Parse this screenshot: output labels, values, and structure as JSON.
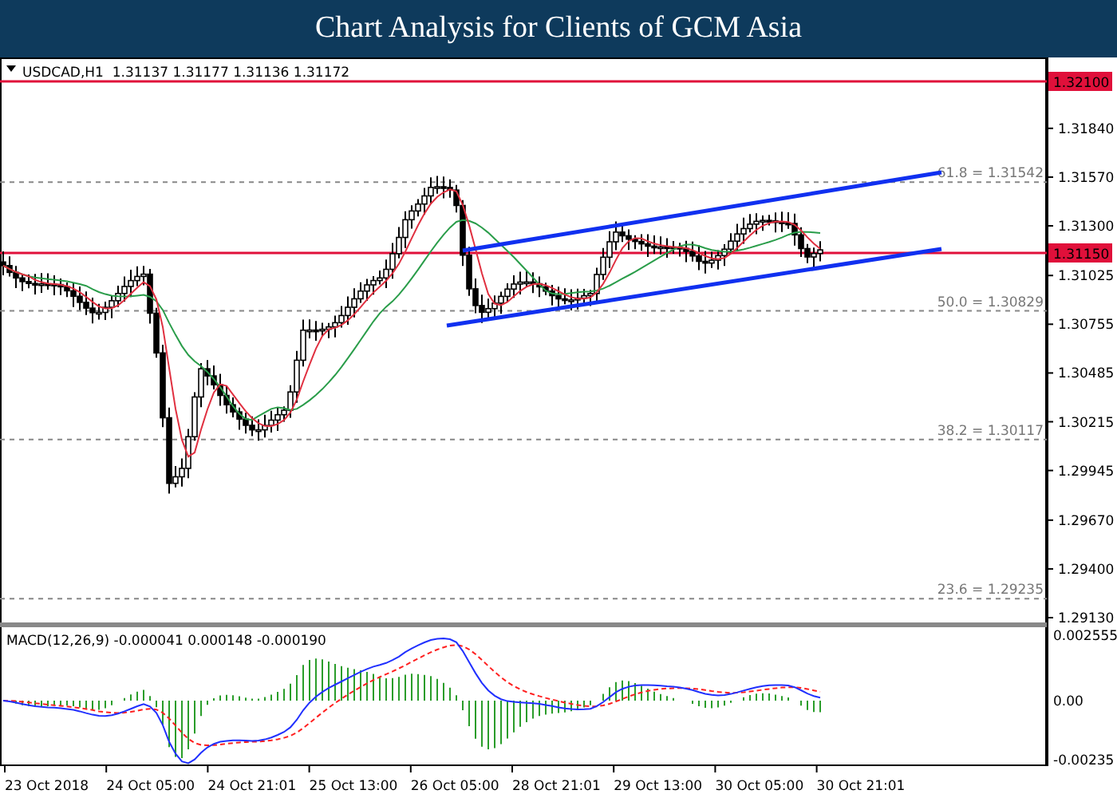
{
  "title": "Chart Analysis for Clients of GCM Asia",
  "chart": {
    "header": "USDCAD,H1  1.31137 1.31177 1.31136 1.31172",
    "price_axis": [
      "1.31840",
      "1.31570",
      "1.31300",
      "1.31025",
      "1.30755",
      "1.30485",
      "1.30215",
      "1.29945",
      "1.29670",
      "1.29400",
      "1.29130"
    ],
    "marked_levels": [
      "1.32100",
      "1.31150"
    ],
    "fibonacci_levels": [
      "61.8 = 1.31542",
      "50.0 = 1.30829",
      "38.2 = 1.30117",
      "23.6 = 1.29235"
    ],
    "time_axis": [
      "23 Oct 2018",
      "24 Oct 05:00",
      "24 Oct 21:01",
      "25 Oct 13:00",
      "26 Oct 05:00",
      "28 Oct 21:01",
      "29 Oct 13:00",
      "30 Oct 05:00",
      "30 Oct 21:01"
    ]
  },
  "macd": {
    "header": "MACD(12,26,9) -0.000041 0.000148 -0.000190",
    "axis": [
      "0.002555",
      "0.00",
      "-0.00235"
    ]
  }
}
